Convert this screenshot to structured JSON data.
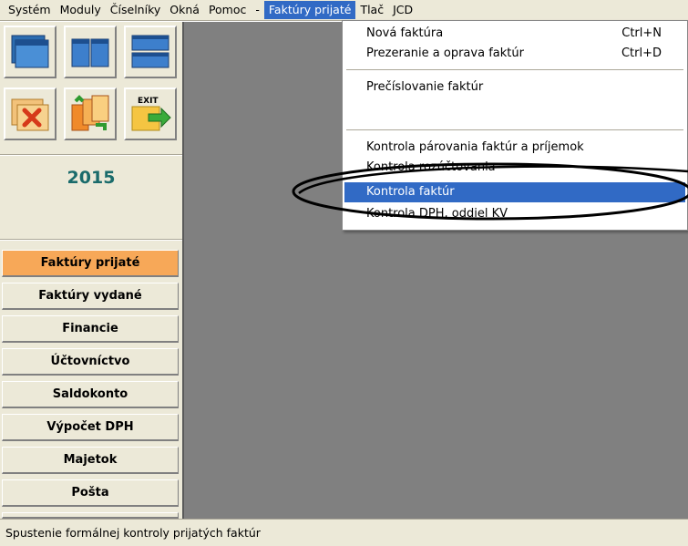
{
  "menubar": {
    "items": [
      "Systém",
      "Moduly",
      "Číselníky",
      "Okná",
      "Pomoc",
      "-",
      "Faktúry prijaté",
      "Tlač",
      "JCD"
    ],
    "active_index": 6
  },
  "toolbar": {
    "icons": [
      "window-cascade-icon",
      "window-tile-vertical-icon",
      "window-tile-horizontal-icon",
      "close-windows-icon",
      "refresh-windows-icon",
      "exit-icon"
    ],
    "exit_label": "EXIT"
  },
  "year": "2015",
  "nav": {
    "items": [
      "Faktúry prijaté",
      "Faktúry vydané",
      "Financie",
      "Účtovníctvo",
      "Saldokonto",
      "Výpočet DPH",
      "Majetok",
      "Pošta"
    ],
    "active_index": 0,
    "active_color": "#f7a858"
  },
  "dropdown": {
    "items": [
      {
        "label": "Nová faktúra",
        "shortcut": "Ctrl+N"
      },
      {
        "label": "Prezeranie a oprava faktúr",
        "shortcut": "Ctrl+D"
      },
      {
        "label": "Prečíslovanie faktúr",
        "shortcut": ""
      },
      {
        "label": "Kontrola párovania faktúr a príjemok",
        "shortcut": ""
      },
      {
        "label": "Kontrola rozúčtovania",
        "shortcut": ""
      },
      {
        "label": "Kontrola faktúr",
        "shortcut": ""
      },
      {
        "label": "Kontrola DPH, oddiel KV",
        "shortcut": ""
      }
    ],
    "highlight_index": 5,
    "highlight_color": "#316ac5"
  },
  "statusbar": {
    "text": "Spustenie formálnej kontroly prijatých faktúr"
  }
}
